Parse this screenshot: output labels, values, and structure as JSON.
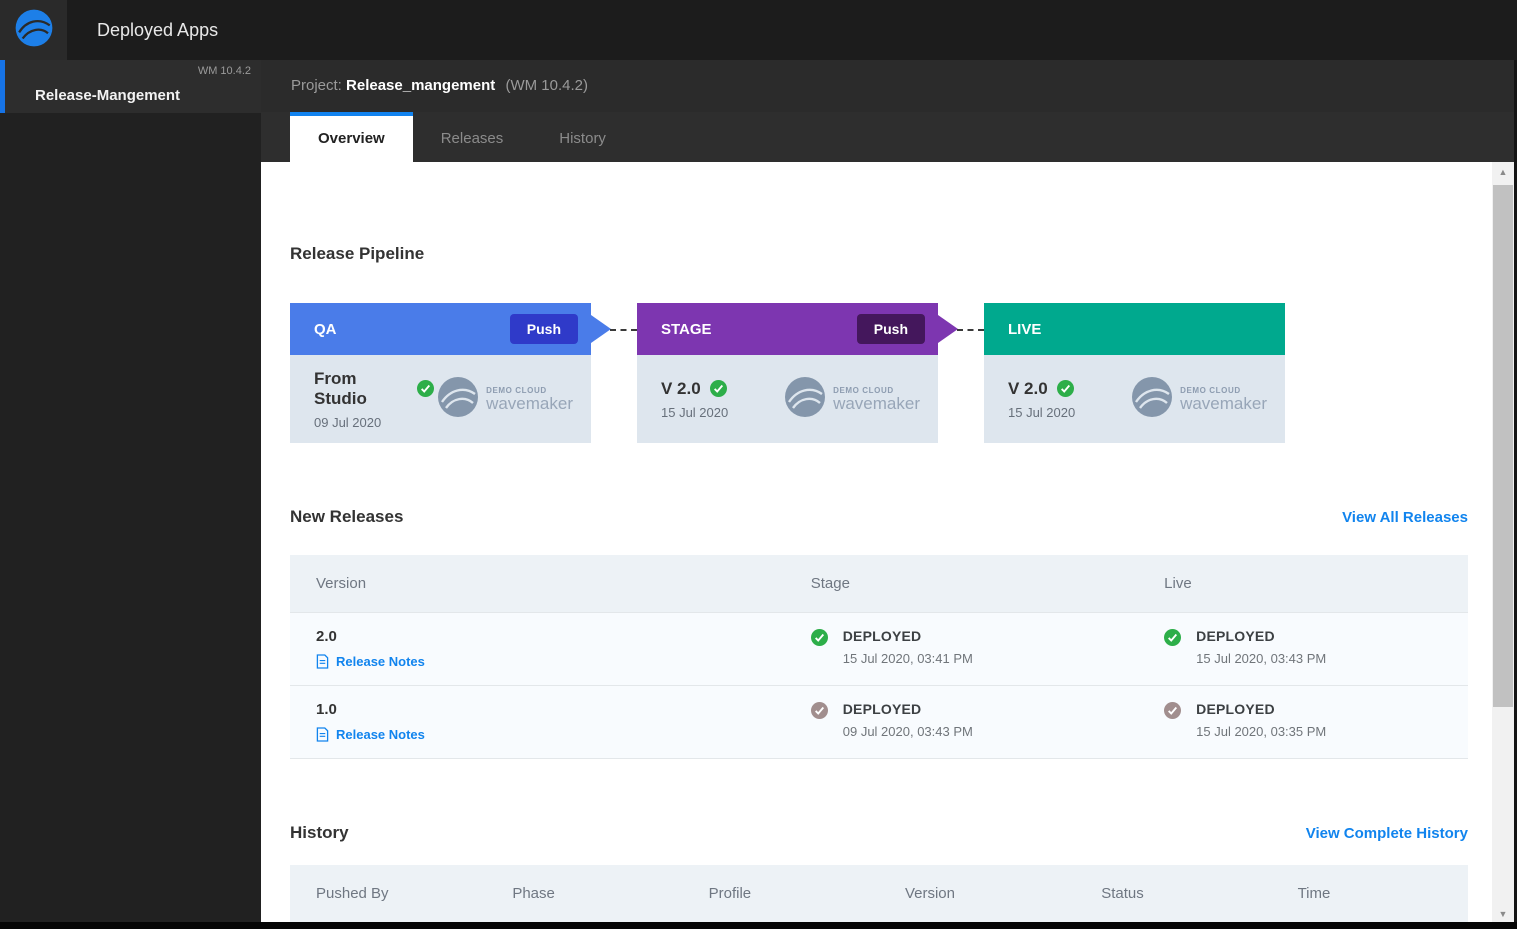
{
  "colors": {
    "accent_blue": "#1283ef",
    "link_blue": "#1184ee",
    "qa_header": "#4a7ce9",
    "qa_push": "#2f3ac9",
    "stage_header": "#7d36b0",
    "stage_push": "#44175c",
    "live_header": "#00a98e",
    "status_green": "#2dae49",
    "status_muted": "#a18e8e",
    "sidebar_active_border": "#1673e6"
  },
  "topbar": {
    "app_title": "Deployed Apps"
  },
  "sidebar": {
    "item": {
      "name": "Release-Mangement",
      "version": "WM 10.4.2"
    }
  },
  "project_header": {
    "prefix": "Project:",
    "name": "Release_mangement",
    "version": "(WM 10.4.2)"
  },
  "tabs": {
    "overview": "Overview",
    "releases": "Releases",
    "history": "History"
  },
  "pipeline": {
    "heading": "Release Pipeline",
    "stages": [
      {
        "name": "QA",
        "push": "Push",
        "version": "From Studio",
        "date": "09 Jul 2020",
        "logo_top": "DEMO CLOUD",
        "logo_bottom": "wavemaker"
      },
      {
        "name": "STAGE",
        "push": "Push",
        "version": "V 2.0",
        "date": "15 Jul 2020",
        "logo_top": "DEMO CLOUD",
        "logo_bottom": "wavemaker"
      },
      {
        "name": "LIVE",
        "version": "V 2.0",
        "date": "15 Jul 2020",
        "logo_top": "DEMO CLOUD",
        "logo_bottom": "wavemaker"
      }
    ]
  },
  "new_releases": {
    "heading": "New Releases",
    "view_all": "View All Releases",
    "columns": [
      "Version",
      "Stage",
      "Live"
    ],
    "rows": [
      {
        "version": "2.0",
        "release_notes": "Release Notes",
        "stage": {
          "status": "DEPLOYED",
          "time": "15 Jul 2020, 03:41 PM"
        },
        "live": {
          "status": "DEPLOYED",
          "time": "15 Jul 2020, 03:43 PM"
        }
      },
      {
        "version": "1.0",
        "release_notes": "Release Notes",
        "stage": {
          "status": "DEPLOYED",
          "time": "09 Jul 2020, 03:43 PM"
        },
        "live": {
          "status": "DEPLOYED",
          "time": "15 Jul 2020, 03:35 PM"
        }
      }
    ]
  },
  "history": {
    "heading": "History",
    "view_all": "View Complete History",
    "columns": [
      "Pushed By",
      "Phase",
      "Profile",
      "Version",
      "Status",
      "Time"
    ]
  }
}
